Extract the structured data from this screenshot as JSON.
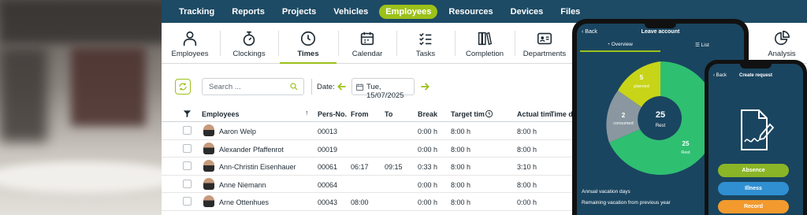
{
  "colors": {
    "brand_navy": "#1d4a64",
    "accent_green": "#9cc11a",
    "pie_green": "#2fbf71",
    "pie_olive": "#c8d418",
    "pie_grey": "#8a97a0",
    "btn_blue": "#2f8fd1",
    "btn_orange": "#f29a2e"
  },
  "top_nav": [
    {
      "label": "Tracking"
    },
    {
      "label": "Reports"
    },
    {
      "label": "Projects"
    },
    {
      "label": "Vehicles"
    },
    {
      "label": "Employees",
      "active": true
    },
    {
      "label": "Resources"
    },
    {
      "label": "Devices"
    },
    {
      "label": "Files"
    }
  ],
  "sub_nav": [
    {
      "label": "Employees",
      "icon": "person-icon"
    },
    {
      "label": "Clockings",
      "icon": "stopwatch-icon"
    },
    {
      "label": "Times",
      "icon": "clock-icon",
      "active": true
    },
    {
      "label": "Calendar",
      "icon": "calendar-icon"
    },
    {
      "label": "Tasks",
      "icon": "checklist-icon"
    },
    {
      "label": "Completion",
      "icon": "books-icon"
    },
    {
      "label": "Departments",
      "icon": "id-card-icon"
    },
    {
      "label": "Analysis",
      "icon": "pie-chart-icon"
    }
  ],
  "toolbar": {
    "search_placeholder": "Search ...",
    "date_label": "Date:",
    "date_value": "Tue, 15/07/2025"
  },
  "table": {
    "headers": [
      "Employees",
      "Pers-No.",
      "From",
      "To",
      "Break",
      "Target tim",
      "Actual tim",
      "Time di"
    ],
    "rows": [
      {
        "name": "Aaron Welp",
        "pers_no": "00013",
        "from": "",
        "to": "",
        "break": "0:00 h",
        "target": "8:00 h",
        "actual": "8:00 h"
      },
      {
        "name": "Alexander Pfaffenrot",
        "pers_no": "00019",
        "from": "",
        "to": "",
        "break": "0:00 h",
        "target": "8:00 h",
        "actual": "8:00 h"
      },
      {
        "name": "Ann-Christin Eisenhauer",
        "pers_no": "00061",
        "from": "06:17",
        "to": "09:15",
        "break": "0:33 h",
        "target": "8:00 h",
        "actual": "3:10 h"
      },
      {
        "name": "Anne Niemann",
        "pers_no": "00064",
        "from": "",
        "to": "",
        "break": "0:00 h",
        "target": "8:00 h",
        "actual": "8:00 h"
      },
      {
        "name": "Arne Ottenhues",
        "pers_no": "00043",
        "from": "08:00",
        "to": "",
        "break": "0:00 h",
        "target": "8:00 h",
        "actual": "0:00 h"
      }
    ]
  },
  "phone_leave": {
    "back": "Back",
    "title": "Leave account",
    "tab_overview": "Overview",
    "tab_list": "List",
    "slices": [
      {
        "label": "planned",
        "value": 5
      },
      {
        "label": "consumed",
        "value": 2
      },
      {
        "label": "Rest",
        "value": 25
      }
    ],
    "center_value": "25",
    "center_label": "Rest",
    "footer_1": "Annual vacation days",
    "footer_2": "Remaining vacation from previous year"
  },
  "phone_request": {
    "back": "Back",
    "title": "Create request",
    "buttons": [
      "Absence",
      "Illness",
      "Record"
    ]
  }
}
